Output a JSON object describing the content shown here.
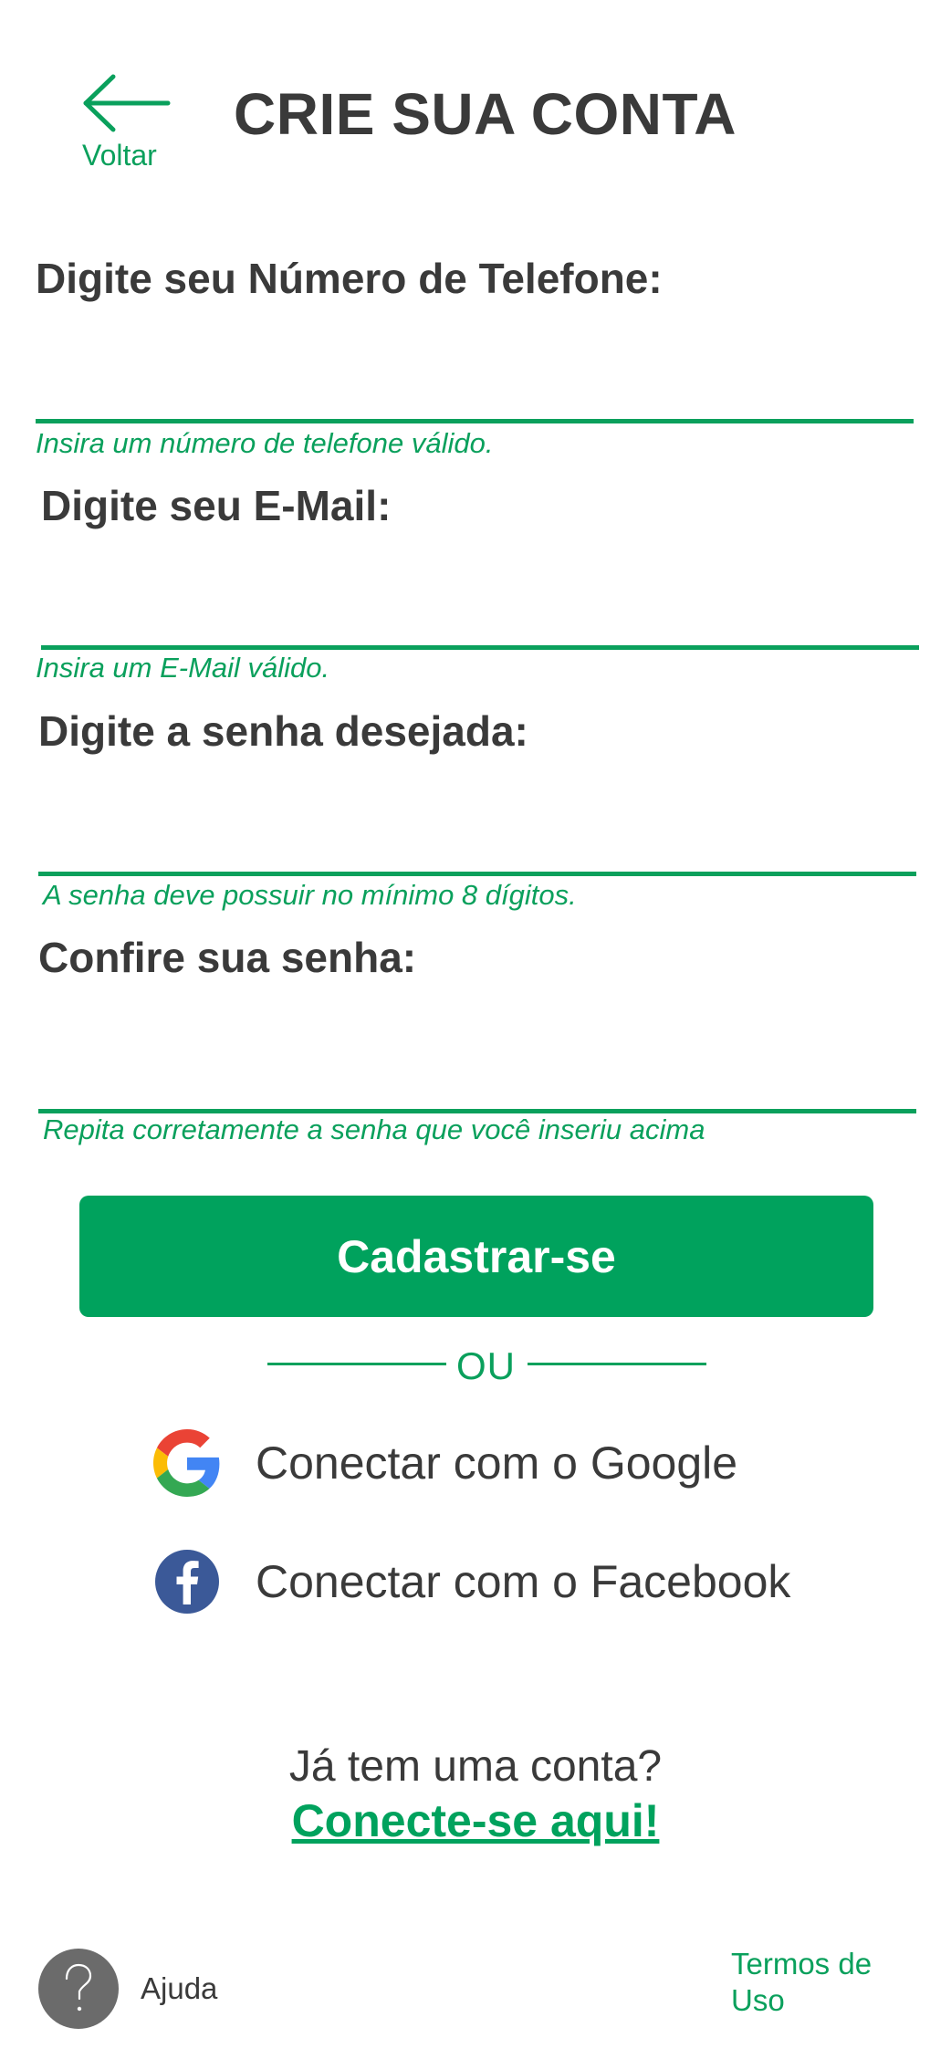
{
  "header": {
    "back_label": "Voltar",
    "title": "CRIE SUA CONTA"
  },
  "form": {
    "phone": {
      "label": "Digite seu Número de Telefone:",
      "value": "",
      "hint": "Insira um número de telefone válido."
    },
    "email": {
      "label": "Digite seu E-Mail:",
      "value": "",
      "hint": "Insira um E-Mail válido."
    },
    "password": {
      "label": "Digite a senha desejada:",
      "value": "",
      "hint": "A senha deve possuir no mínimo 8 dígitos."
    },
    "confirm_password": {
      "label": "Confire sua senha:",
      "value": "",
      "hint": "Repita corretamente a senha que você inseriu acima"
    },
    "submit_label": "Cadastrar-se"
  },
  "divider_text": "OU",
  "social": {
    "google_label": "Conectar com o Google",
    "facebook_label": "Conectar com o Facebook"
  },
  "login": {
    "question": "Já tem uma conta?",
    "link_label": "Conecte-se aqui!"
  },
  "footer": {
    "help_label": "Ajuda",
    "terms_label": "Termos de Uso"
  },
  "colors": {
    "accent": "#00a25d",
    "text": "#3a3a3a",
    "help_circle": "#6b6b6b",
    "facebook": "#3b5998"
  },
  "icons": {
    "back": "arrow-left-icon",
    "google": "google-logo-icon",
    "facebook": "facebook-logo-icon",
    "help": "question-mark-icon"
  }
}
